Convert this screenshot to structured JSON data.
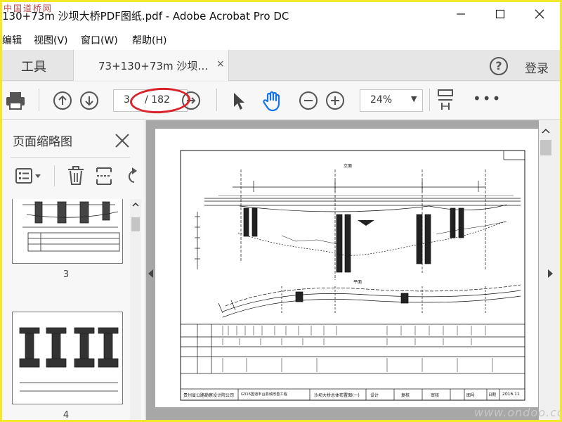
{
  "window": {
    "title": "130+73m 沙坝大桥PDF图纸.pdf - Adobe Acrobat Pro DC",
    "watermark": "中国道桥网"
  },
  "menu": {
    "items": [
      "编辑",
      "视图(V)",
      "窗口(W)",
      "帮助(H)"
    ]
  },
  "tabs": {
    "tools_label": "工具",
    "document_label": "73+130+73m 沙坝…",
    "close_glyph": "×",
    "login_label": "登录",
    "help_glyph": "?"
  },
  "toolbar": {
    "current_page": "3",
    "total_pages": "/ 182",
    "zoom": "24%",
    "more_glyph": "•••"
  },
  "sidebar": {
    "title": "页面缩略图",
    "pages": [
      {
        "label": "3"
      },
      {
        "label": "4"
      }
    ]
  },
  "drawing": {
    "stamp_left": "贵州省公路勘察设计院公司",
    "stamp_project": "G316国道丰台县城改善工程",
    "stamp_title": "沙坝大桥总体布置图(一)",
    "stamp_design": "设计",
    "stamp_review": "复核",
    "stamp_approve": "审核",
    "stamp_drawing_no": "图号",
    "stamp_date_label": "日期",
    "stamp_date": "2016.11",
    "section_elevation": "立面",
    "section_plan": "平面"
  },
  "colors": {
    "accent_blue": "#1473e6",
    "annotation_red": "#d9232a",
    "frame_yellow": "#f3e82a"
  },
  "footer": {
    "site": "www.ondoo.com"
  }
}
